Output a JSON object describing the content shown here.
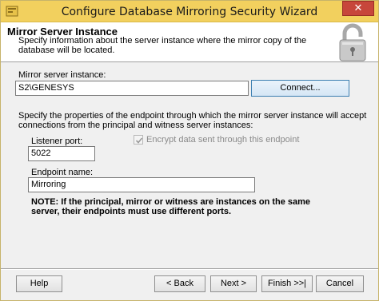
{
  "window": {
    "title": "Configure Database Mirroring Security Wizard",
    "close_label": "✕"
  },
  "header": {
    "title": "Mirror Server Instance",
    "subtitle": "Specify information about the server instance where the mirror copy of the database will be located."
  },
  "form": {
    "mirror_instance_label": "Mirror server instance:",
    "mirror_instance_value": "S2\\GENESYS",
    "connect_label": "Connect...",
    "endpoint_description": "Specify the properties of the endpoint through which the mirror server instance will accept connections from the principal and witness server instances:",
    "listener_port_label": "Listener port:",
    "listener_port_value": "5022",
    "encrypt_label": "Encrypt data sent through this endpoint",
    "encrypt_checked": true,
    "endpoint_name_label": "Endpoint name:",
    "endpoint_name_value": "Mirroring",
    "note": "NOTE: If the principal, mirror or witness are instances on the same server, their endpoints must use different ports."
  },
  "footer": {
    "help_label": "Help",
    "back_label": "< Back",
    "next_label": "Next >",
    "finish_label": "Finish >>|",
    "cancel_label": "Cancel"
  }
}
